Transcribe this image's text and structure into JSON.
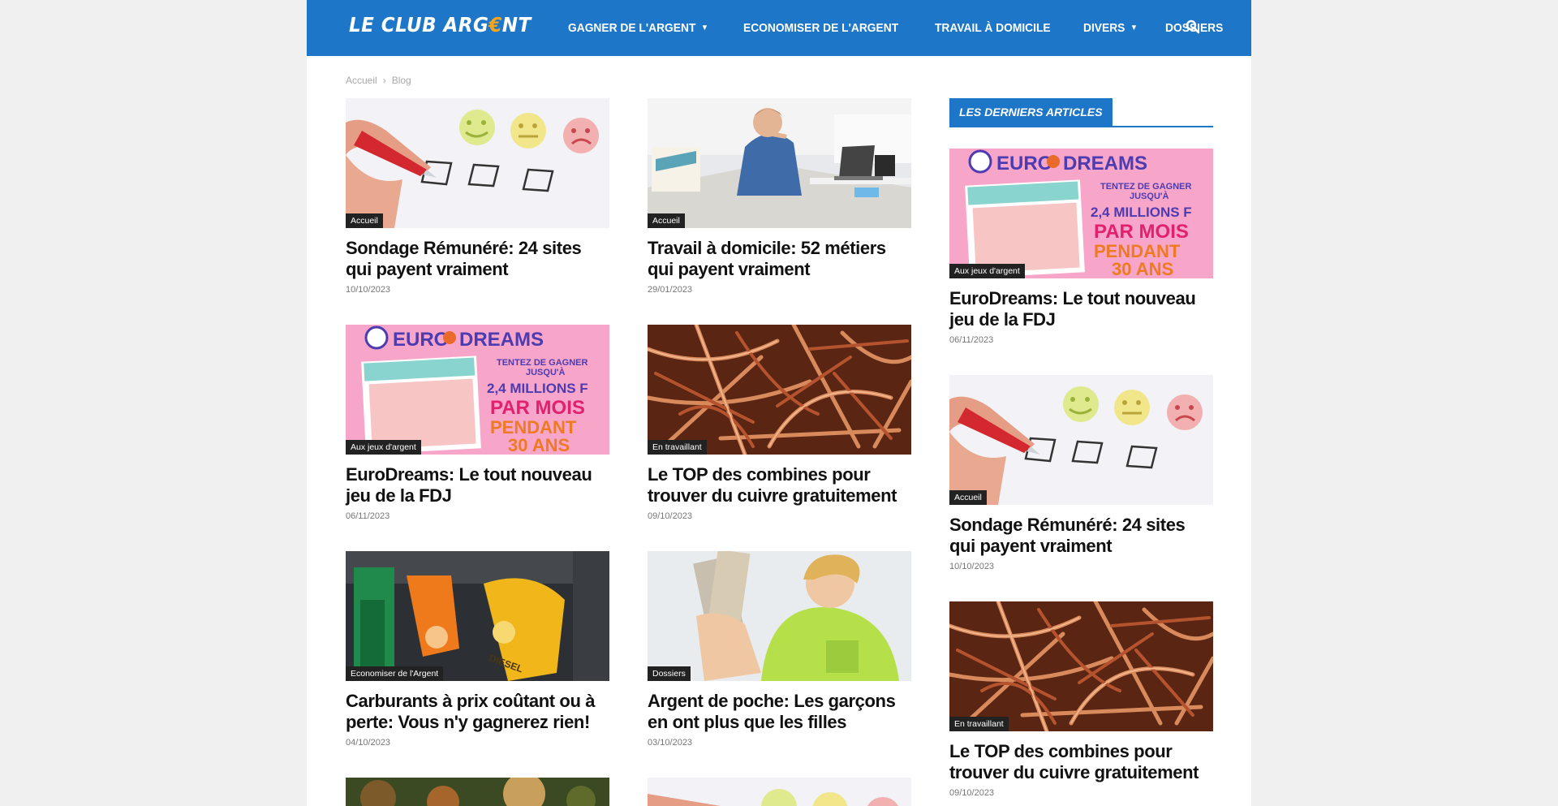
{
  "site": {
    "logo_main": "LE CLUB ARG",
    "logo_euro": "€",
    "logo_end": "NT"
  },
  "nav": {
    "items": [
      {
        "label": "GAGNER DE L'ARGENT",
        "dropdown": true
      },
      {
        "label": "ECONOMISER DE L'ARGENT",
        "dropdown": false
      },
      {
        "label": "TRAVAIL À DOMICILE",
        "dropdown": false
      },
      {
        "label": "DIVERS",
        "dropdown": true
      },
      {
        "label": "DOSSIERS",
        "dropdown": false
      }
    ],
    "search_icon": "search-icon"
  },
  "breadcrumb": {
    "home": "Accueil",
    "separator": "›",
    "current": "Blog"
  },
  "posts": [
    {
      "category": "Accueil",
      "title": "Sondage Rémunéré: 24 sites qui payent vraiment",
      "date": "10/10/2023",
      "image": "survey"
    },
    {
      "category": "Accueil",
      "title": "Travail à domicile: 52 métiers qui payent vraiment",
      "date": "29/01/2023",
      "image": "office"
    },
    {
      "category": "Aux jeux d'argent",
      "title": "EuroDreams: Le tout nouveau jeu de la FDJ",
      "date": "06/11/2023",
      "image": "eurodreams"
    },
    {
      "category": "En travaillant",
      "title": "Le TOP des combines pour trouver du cuivre gratuitement",
      "date": "09/10/2023",
      "image": "copper"
    },
    {
      "category": "Economiser de l'Argent",
      "title": "Carburants à prix coûtant ou à perte: Vous n'y gagnerez rien!",
      "date": "04/10/2023",
      "image": "fuel"
    },
    {
      "category": "Dossiers",
      "title": "Argent de poche: Les garçons en ont plus que les filles",
      "date": "03/10/2023",
      "image": "pocket-money"
    }
  ],
  "sidebar": {
    "widget_title": "LES DERNIERS ARTICLES",
    "posts": [
      {
        "category": "Aux jeux d'argent",
        "title": "EuroDreams: Le tout nouveau jeu de la FDJ",
        "date": "06/11/2023",
        "image": "eurodreams"
      },
      {
        "category": "Accueil",
        "title": "Sondage Rémunéré: 24 sites qui payent vraiment",
        "date": "10/10/2023",
        "image": "survey"
      },
      {
        "category": "En travaillant",
        "title": "Le TOP des combines pour trouver du cuivre gratuitement",
        "date": "09/10/2023",
        "image": "copper"
      }
    ]
  },
  "eurodreams_banner": {
    "brand_left": "EURO",
    "brand_right": "DREAMS",
    "line1": "TENTEZ DE GAGNER",
    "line2": "JUSQU'À",
    "line3": "2,4 MILLIONS F",
    "line4": "PAR MOIS",
    "line5": "PENDANT",
    "line6": "30 ANS"
  },
  "fuel_label": "DIESEL",
  "colors": {
    "header": "#1d76c7",
    "accent_euro": "#f4a51c",
    "category_badge": "#222222"
  }
}
